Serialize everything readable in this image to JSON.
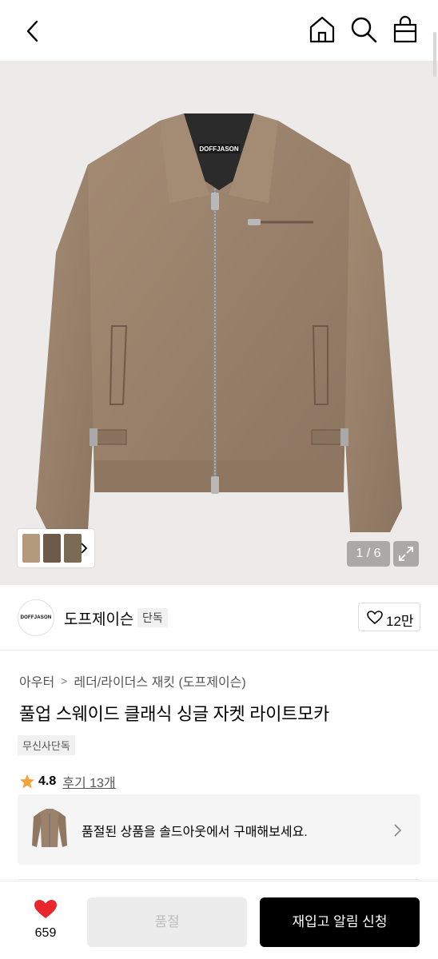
{
  "header": {
    "icons": [
      "back-icon",
      "home-icon",
      "search-icon",
      "shopping-bag-icon"
    ]
  },
  "gallery": {
    "counter": "1 / 6",
    "label_on_item": "DOFFJASON",
    "jacket_color": "#9b826c"
  },
  "brand": {
    "logo_text": "DOFFJASON",
    "name": "도프제이슨",
    "tag": "단독",
    "likes": "12만"
  },
  "breadcrumb": {
    "items": [
      "아우터",
      "레더/라이더스 재킷 (도프제이슨)"
    ],
    "separator": ">"
  },
  "product": {
    "title": "풀업 스웨이드 클래식 싱글 자켓 라이트모카",
    "badge": "무신사단독",
    "rating": "4.8",
    "reviews": "후기 13개"
  },
  "soldout_notice": {
    "message": "품절된 상품을 솔드아웃에서 구매해보세요."
  },
  "bottom_bar": {
    "like_count": "659",
    "soldout_label": "품절",
    "restock_label": "재입고 알림 신청"
  },
  "colors": {
    "accent_red": "#e8262c",
    "star": "#f2a33a",
    "primary_button": "#000000"
  }
}
